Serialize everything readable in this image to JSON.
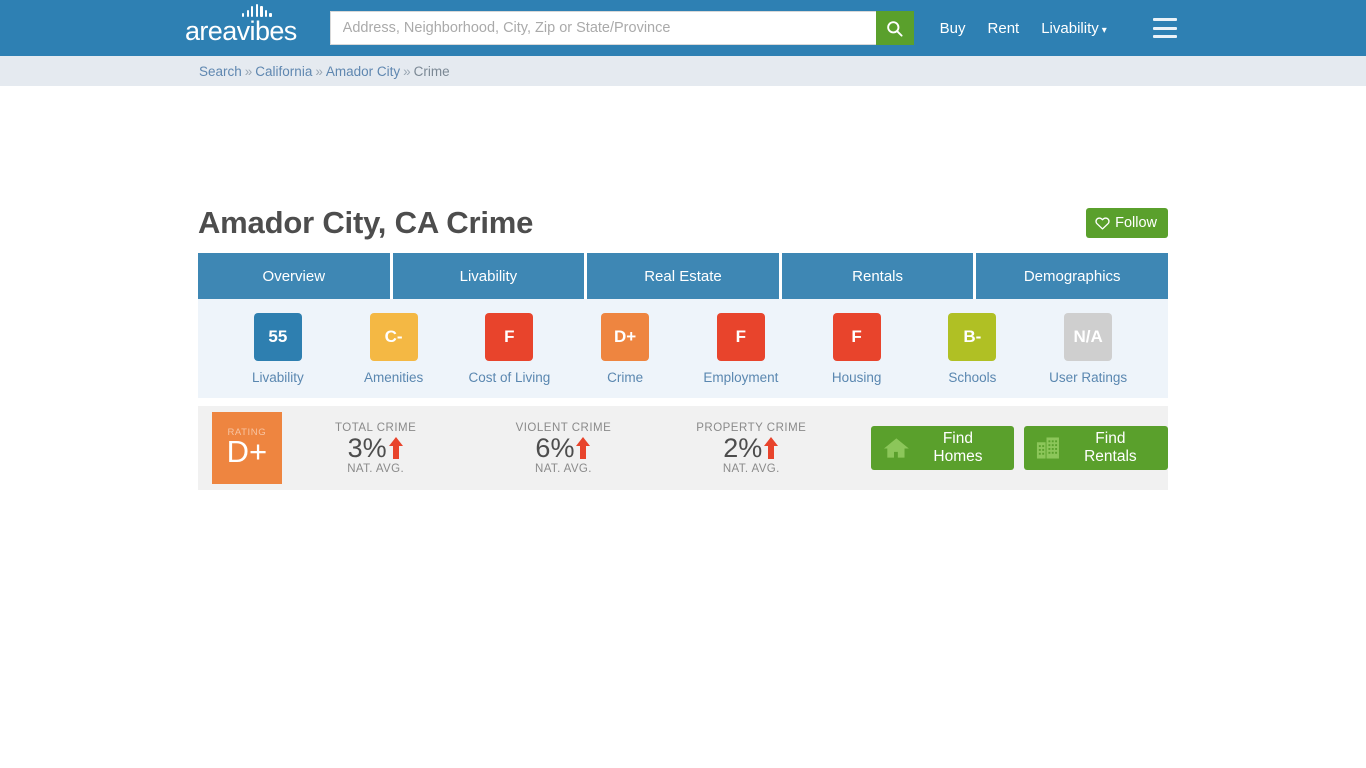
{
  "header": {
    "logo_text": "areavibes",
    "search": {
      "placeholder": "Address, Neighborhood, City, Zip or State/Province",
      "value": ""
    },
    "nav": [
      {
        "label": "Buy"
      },
      {
        "label": "Rent"
      },
      {
        "label": "Livability",
        "caret": "▾"
      }
    ]
  },
  "breadcrumb": {
    "items": [
      {
        "label": "Search",
        "link": true
      },
      {
        "label": "California",
        "link": true
      },
      {
        "label": "Amador City",
        "link": true
      },
      {
        "label": "Crime",
        "link": false
      }
    ],
    "separator": "»"
  },
  "page": {
    "title": "Amador City, CA Crime",
    "follow_label": "Follow"
  },
  "tabs": [
    {
      "label": "Overview"
    },
    {
      "label": "Livability"
    },
    {
      "label": "Real Estate"
    },
    {
      "label": "Rentals"
    },
    {
      "label": "Demographics"
    }
  ],
  "scores": [
    {
      "label": "Livability",
      "value": "55",
      "color": "#2e7fb0"
    },
    {
      "label": "Amenities",
      "value": "C-",
      "color": "#f4b844"
    },
    {
      "label": "Cost of Living",
      "value": "F",
      "color": "#e8442c"
    },
    {
      "label": "Crime",
      "value": "D+",
      "color": "#ee8540"
    },
    {
      "label": "Employment",
      "value": "F",
      "color": "#e8442c"
    },
    {
      "label": "Housing",
      "value": "F",
      "color": "#e8442c"
    },
    {
      "label": "Schools",
      "value": "B-",
      "color": "#b0c024"
    },
    {
      "label": "User Ratings",
      "value": "N/A",
      "color": "#cfcfcf"
    }
  ],
  "crime_panel": {
    "rating": {
      "caption": "RATING",
      "grade": "D+",
      "color": "#ee8540"
    },
    "stats": [
      {
        "caption": "TOTAL CRIME",
        "value": "3%",
        "trend": "up",
        "sub": "NAT. AVG."
      },
      {
        "caption": "VIOLENT CRIME",
        "value": "6%",
        "trend": "up",
        "sub": "NAT. AVG."
      },
      {
        "caption": "PROPERTY CRIME",
        "value": "2%",
        "trend": "up",
        "sub": "NAT. AVG."
      }
    ],
    "ctas": [
      {
        "label": "Find Homes",
        "icon": "home-icon"
      },
      {
        "label": "Find Rentals",
        "icon": "building-icon"
      }
    ]
  },
  "theme": {
    "header_blue": "#2e80b3",
    "tab_blue": "#3e87b4",
    "green": "#5aa02c",
    "arrow_red": "#e8442c"
  }
}
